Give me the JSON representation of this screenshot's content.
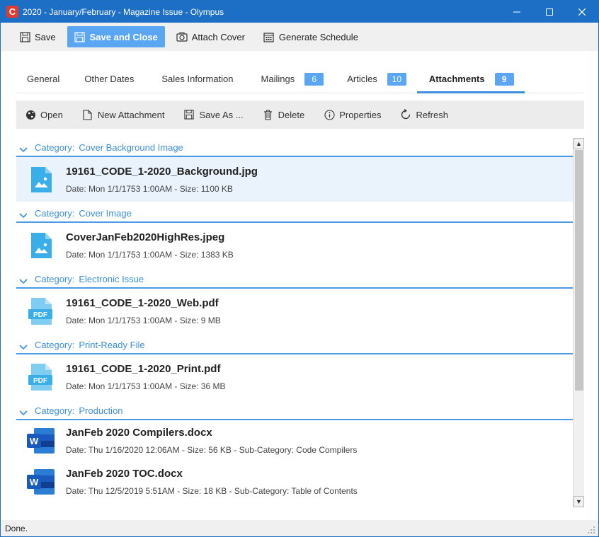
{
  "window": {
    "title": "2020 - January/February - Magazine Issue - Olympus",
    "app_icon_letter": "C"
  },
  "toolbar": {
    "save_label": "Save",
    "save_close_label": "Save and Close",
    "attach_cover_label": "Attach Cover",
    "generate_schedule_label": "Generate Schedule"
  },
  "tabs": {
    "general": "General",
    "other_dates": "Other Dates",
    "sales_information": "Sales Information",
    "mailings": "Mailings",
    "mailings_count": "6",
    "articles": "Articles",
    "articles_count": "10",
    "attachments": "Attachments",
    "attachments_count": "9"
  },
  "actions": {
    "open": "Open",
    "new_attachment": "New Attachment",
    "save_as": "Save As ...",
    "delete": "Delete",
    "properties": "Properties",
    "refresh": "Refresh"
  },
  "category_prefix": "Category:",
  "categories": [
    {
      "name": "Cover Background Image",
      "items": [
        {
          "name": "19161_CODE_1-2020_Background.jpg",
          "meta": "Date: Mon 1/1/1753 1:00AM - Size: 1100 KB",
          "icon": "image-file-icon"
        }
      ]
    },
    {
      "name": "Cover Image",
      "items": [
        {
          "name": "CoverJanFeb2020HighRes.jpeg",
          "meta": "Date: Mon 1/1/1753 1:00AM - Size: 1383 KB",
          "icon": "image-file-icon"
        }
      ]
    },
    {
      "name": "Electronic Issue",
      "items": [
        {
          "name": "19161_CODE_1-2020_Web.pdf",
          "meta": "Date: Mon 1/1/1753 1:00AM - Size: 9 MB",
          "icon": "pdf-file-icon",
          "icon_text": "PDF"
        }
      ]
    },
    {
      "name": "Print-Ready File",
      "items": [
        {
          "name": "19161_CODE_1-2020_Print.pdf",
          "meta": "Date: Mon 1/1/1753 1:00AM - Size: 36 MB",
          "icon": "pdf-file-icon",
          "icon_text": "PDF"
        }
      ]
    },
    {
      "name": "Production",
      "items": [
        {
          "name": "JanFeb 2020 Compilers.docx",
          "meta": "Date: Thu 1/16/2020 12:06AM - Size: 56 KB - Sub-Category: Code Compilers",
          "icon": "word-file-icon",
          "icon_text": "W"
        },
        {
          "name": "JanFeb 2020 TOC.docx",
          "meta": "Date: Thu 12/5/2019 5:51AM - Size: 18 KB - Sub-Category: Table of Contents",
          "icon": "word-file-icon",
          "icon_text": "W"
        }
      ]
    }
  ],
  "status": "Done.",
  "colors": {
    "titlebar": "#1c6fc4",
    "accent": "#3c8fe0",
    "badge": "#5aa6f2",
    "selected_row": "#eaf3fb"
  }
}
